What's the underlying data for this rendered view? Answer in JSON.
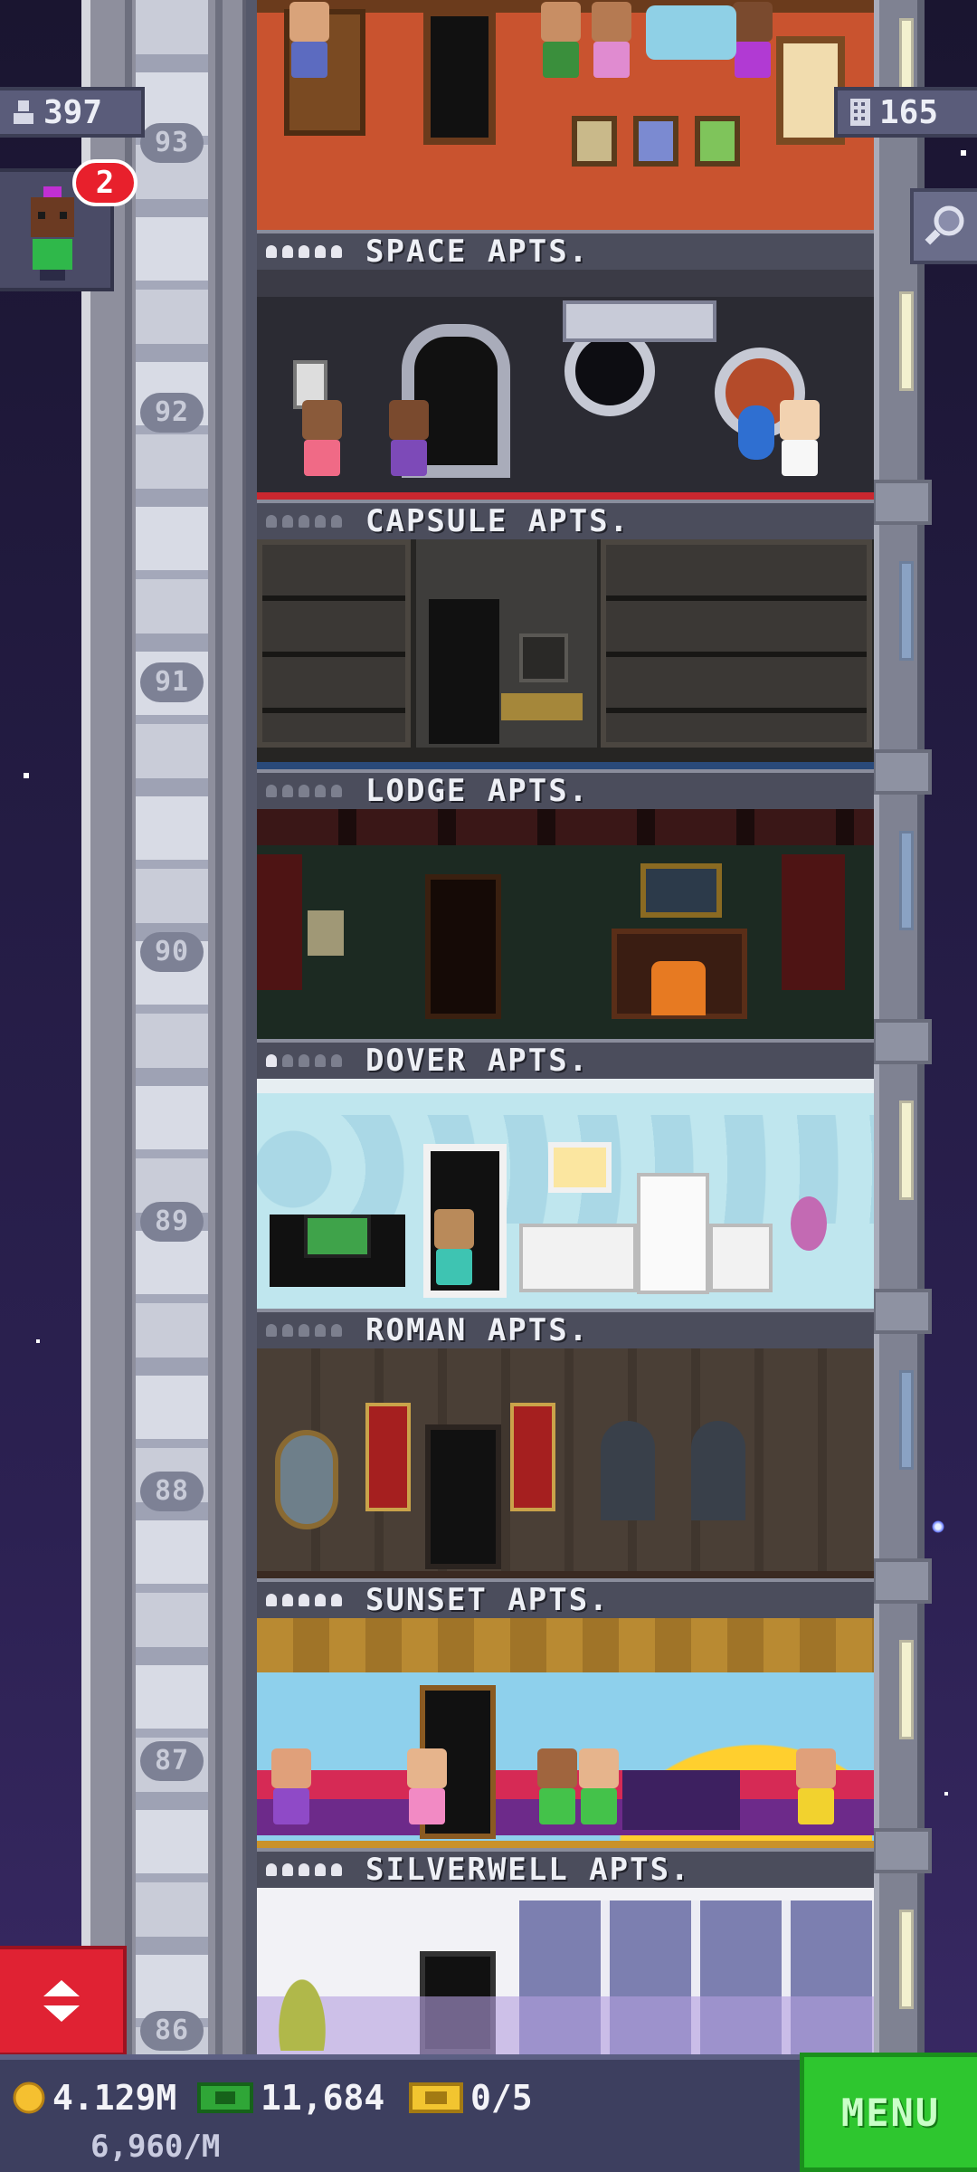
{
  "hud": {
    "population": "397",
    "floors_count": "165",
    "notification_count": "2"
  },
  "floors": [
    {
      "number": "93",
      "name": "SPACE APTS.",
      "occupancy": 5
    },
    {
      "number": "92",
      "name": "CAPSULE APTS.",
      "occupancy": 0
    },
    {
      "number": "91",
      "name": "LODGE APTS.",
      "occupancy": 0
    },
    {
      "number": "90",
      "name": "DOVER APTS.",
      "occupancy": 1
    },
    {
      "number": "89",
      "name": "ROMAN APTS.",
      "occupancy": 0
    },
    {
      "number": "88",
      "name": "SUNSET APTS.",
      "occupancy": 5
    },
    {
      "number": "87",
      "name": "SILVERWELL APTS.",
      "occupancy": 5
    },
    {
      "number": "86",
      "name": "",
      "occupancy": 0
    }
  ],
  "bottom_bar": {
    "coins": "4.129M",
    "coins_rate": "6,960/M",
    "bux": "11,684",
    "tickets": "0/5",
    "menu_label": "MENU"
  },
  "colors": {
    "menu_green": "#2ec62f",
    "elevator_red": "#e02233",
    "badge_red": "#e8202c"
  },
  "icons": {
    "population": "person-icon",
    "floors": "building-icon",
    "search": "magnifier-icon",
    "coin": "coin-icon",
    "bux": "bux-icon",
    "ticket": "ticket-icon",
    "elevator": "elevator-updown-icon"
  }
}
